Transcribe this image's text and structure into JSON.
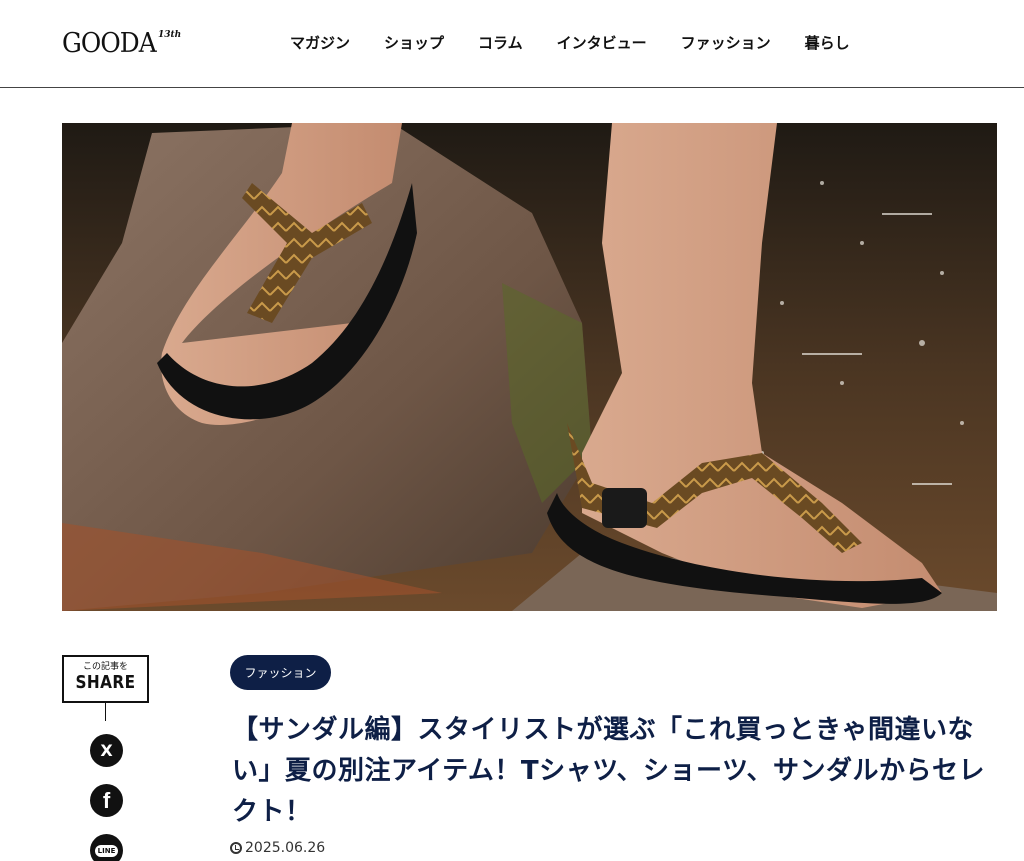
{
  "header": {
    "logo": "GOODA",
    "logo_sup": "13th",
    "nav": [
      "マガジン",
      "ショップ",
      "コラム",
      "インタビュー",
      "ファッション",
      "暮らし"
    ]
  },
  "share": {
    "small": "この記事を",
    "big": "SHARE",
    "x_icon": "X",
    "fb_icon": "f",
    "line_icon": "LINE"
  },
  "article": {
    "category": "ファッション",
    "title": "【サンダル編】スタイリストが選ぶ「これ買っときゃ間違いない」夏の別注アイテム！Tシャツ、ショーツ、サンダルからセレクト！",
    "date": "2025.06.26"
  },
  "colors": {
    "navy": "#0e1f46"
  }
}
